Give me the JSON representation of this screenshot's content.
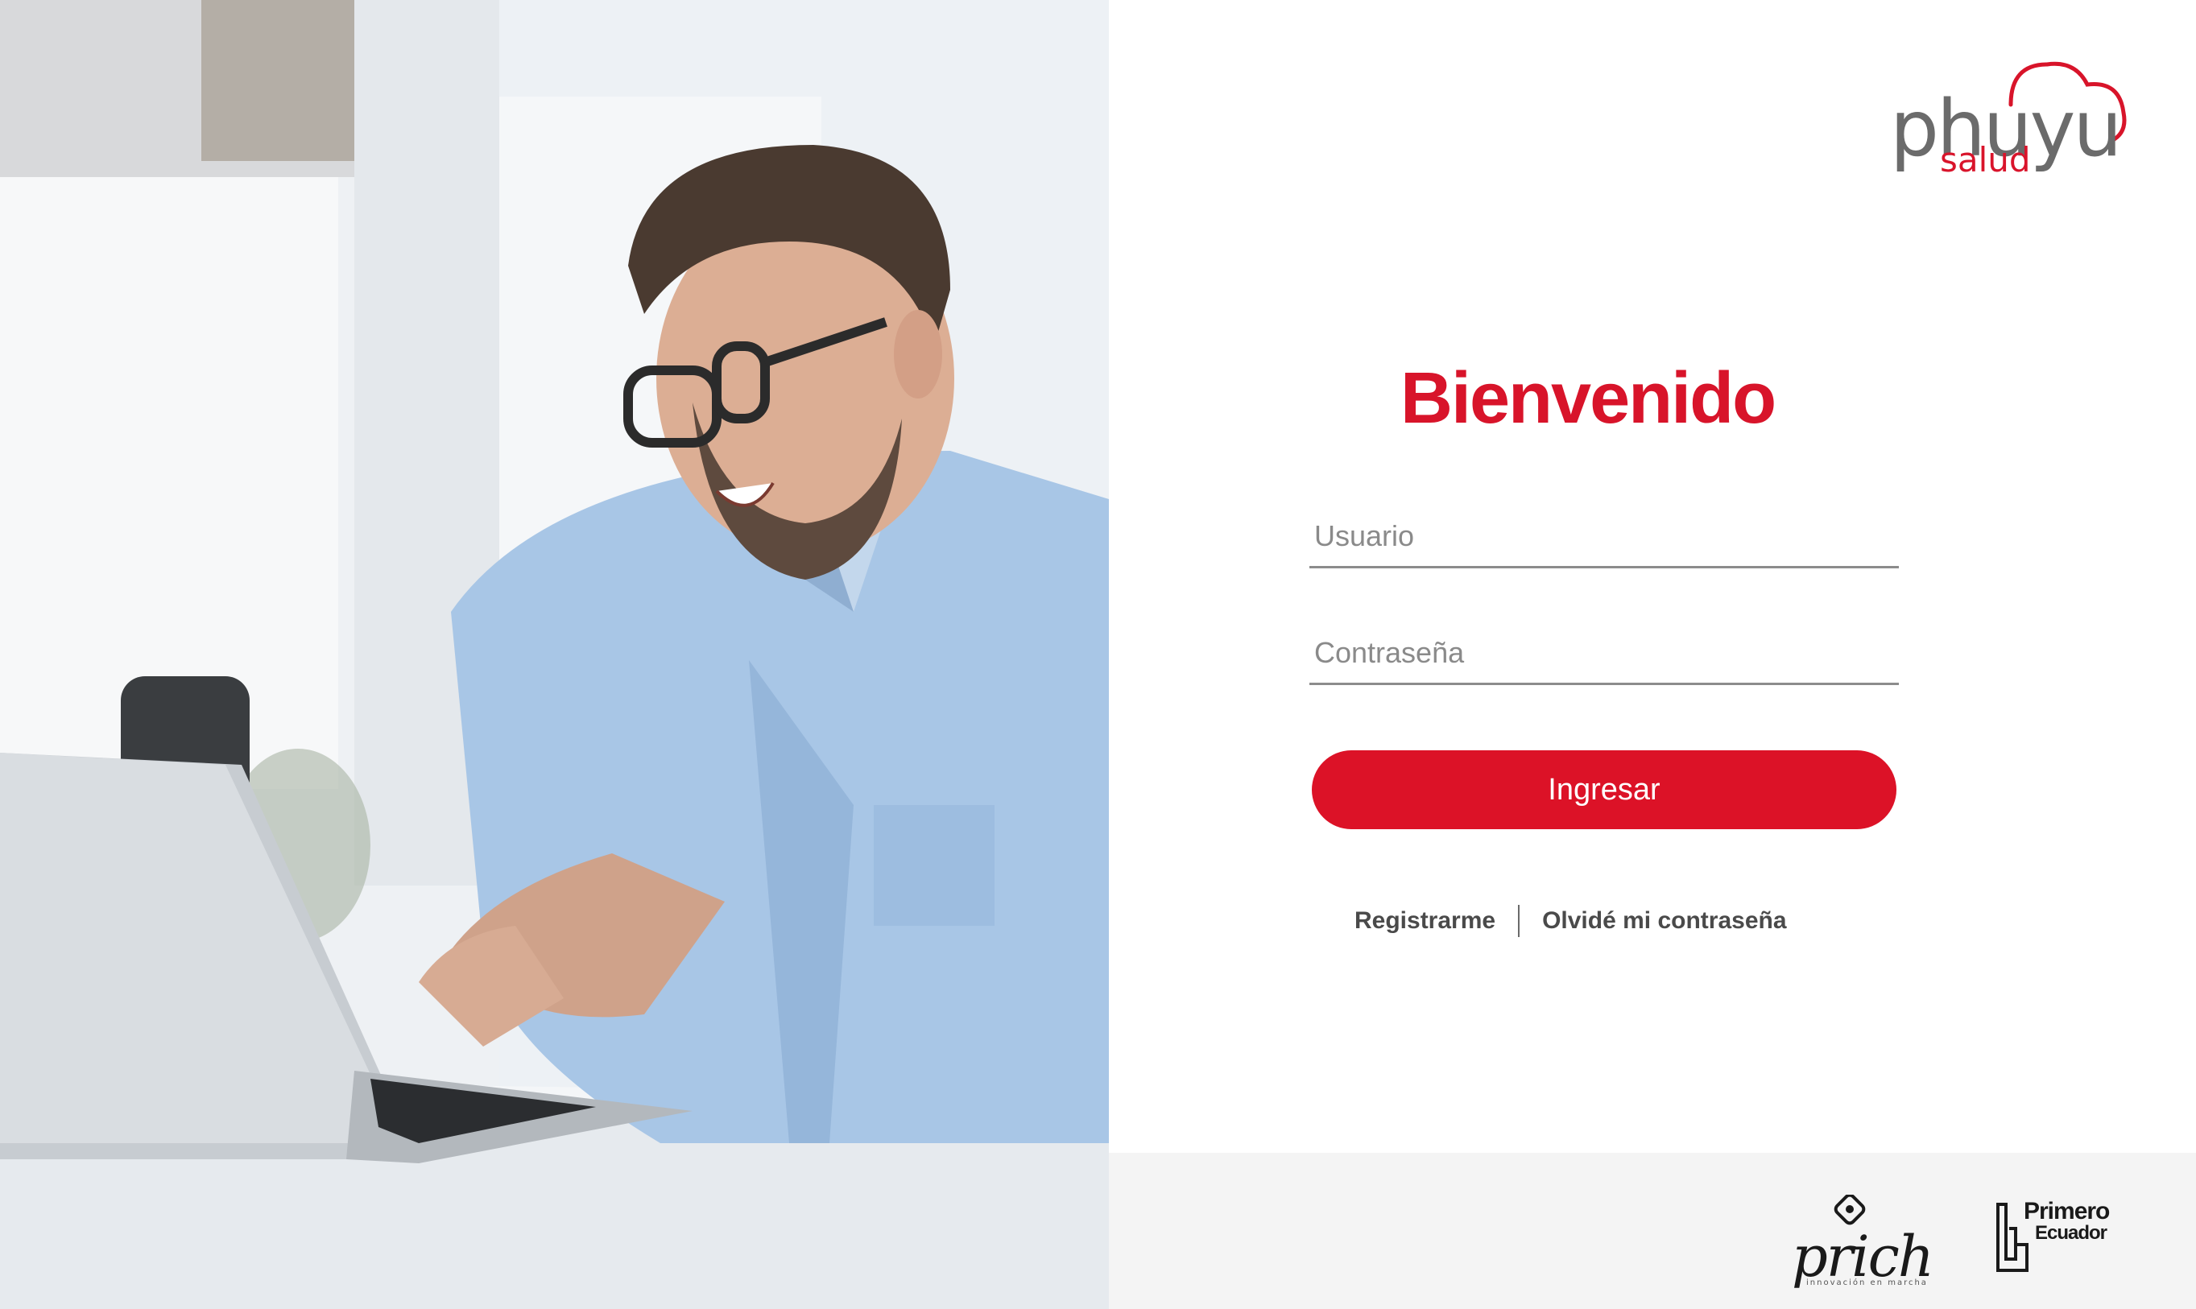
{
  "brand": {
    "name": "phuyu",
    "subtitle": "salud",
    "accent_color": "#d8142a"
  },
  "login": {
    "title": "Bienvenido",
    "username_placeholder": "Usuario",
    "password_placeholder": "Contraseña",
    "submit_label": "Ingresar",
    "register_link": "Registrarme",
    "forgot_link": "Olvidé mi contraseña"
  },
  "partners": {
    "prich_name": "prich",
    "prich_tagline": "innovación en marcha",
    "primero_line1": "Primero",
    "primero_line2": "Ecuador"
  },
  "hero_image": {
    "icon": "man-with-laptop-illustration"
  }
}
